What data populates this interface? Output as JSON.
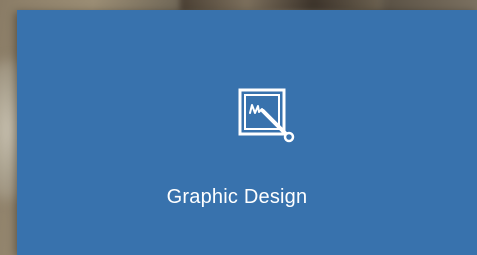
{
  "tile": {
    "label": "Graphic Design",
    "icon": "graphic-design-icon",
    "background_color": "#3872ad",
    "text_color": "#ffffff"
  }
}
